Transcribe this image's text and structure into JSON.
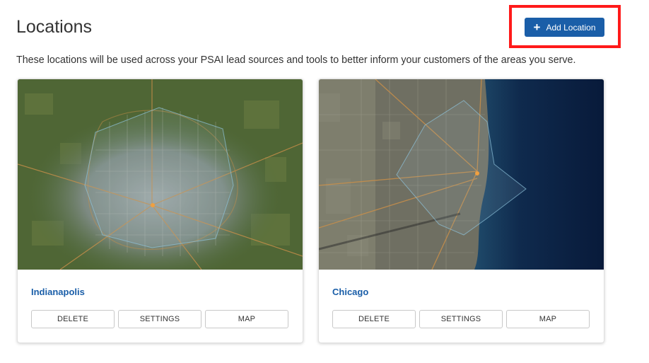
{
  "header": {
    "title": "Locations",
    "add_button_label": "Add Location",
    "add_icon": "plus-icon"
  },
  "description": "These locations will be used across your PSAI lead sources and tools to better inform your customers of the areas you serve.",
  "colors": {
    "accent": "#1a5ea8",
    "highlight": "#ff1a1a"
  },
  "locations": [
    {
      "name": "Indianapolis",
      "map_style": "satellite",
      "buttons": {
        "delete": "DELETE",
        "settings": "SETTINGS",
        "map": "MAP"
      }
    },
    {
      "name": "Chicago",
      "map_style": "satellite",
      "buttons": {
        "delete": "DELETE",
        "settings": "SETTINGS",
        "map": "MAP"
      }
    }
  ]
}
